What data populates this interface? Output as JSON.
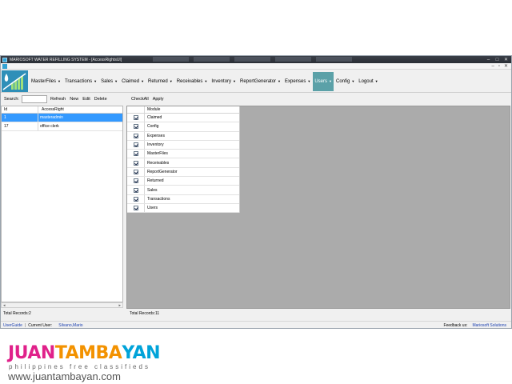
{
  "window": {
    "title": "MARIOSOFT WATER REFILLING SYSTEM - [AccessRightsUI]",
    "controls": [
      "–",
      "□",
      "✕"
    ],
    "child_controls": [
      "–",
      "▫",
      "✕"
    ]
  },
  "menu": {
    "items": [
      {
        "label": "MasterFiles",
        "caret": "▼"
      },
      {
        "label": "Transactions",
        "caret": "▼"
      },
      {
        "label": "Sales",
        "caret": "▼"
      },
      {
        "label": "Claimed",
        "caret": "▼"
      },
      {
        "label": "Returned",
        "caret": "▼"
      },
      {
        "label": "Receivables",
        "caret": "▼"
      },
      {
        "label": "Inventory",
        "caret": "▼"
      },
      {
        "label": "ReportGenerator",
        "caret": "▼"
      },
      {
        "label": "Expenses",
        "caret": "▼"
      },
      {
        "label": "Users",
        "caret": "▼",
        "active": true
      },
      {
        "label": "Config",
        "caret": "▼"
      },
      {
        "label": "Logout",
        "caret": "▼"
      }
    ]
  },
  "left_toolbar": {
    "search_label": "Search:",
    "search_value": "",
    "refresh": "Refresh",
    "new": "New",
    "edit": "Edit",
    "delete": "Delete"
  },
  "access_grid": {
    "headers": [
      "Id",
      "AccessRight"
    ],
    "rows": [
      {
        "id": "1",
        "name": "masteradmin",
        "selected": true
      },
      {
        "id": "17",
        "name": "office clerk",
        "selected": false
      }
    ],
    "scroll_left": "◂",
    "scroll_right": "▸",
    "footer": "Total Records:2"
  },
  "right_toolbar": {
    "check_all": "CheckAll",
    "apply": "Apply"
  },
  "module_grid": {
    "header": "Module",
    "rows": [
      "Claimed",
      "Config",
      "Expenses",
      "Inventory",
      "MasterFiles",
      "Receivables",
      "ReportGenerator",
      "Returned",
      "Sales",
      "Transactions",
      "Users"
    ],
    "footer": "Total Records:11"
  },
  "status": {
    "user_guide": "UserGuide",
    "separator": "|",
    "current_user_label": "Current User:",
    "current_user_value": "Silvano,Mario",
    "feedback_label": "Feedback us:",
    "company": "Mariosoft Solutions"
  },
  "watermark": {
    "logo_part1": "JUAN",
    "logo_part2": "TAMBA",
    "logo_part3": "YAN",
    "tagline": "philippines   free classifieds",
    "url": "www.juantambayan.com"
  },
  "colors": {
    "selected_row": "#3399ff",
    "active_menu": "#5ba1a8",
    "workspace": "#ababab"
  }
}
